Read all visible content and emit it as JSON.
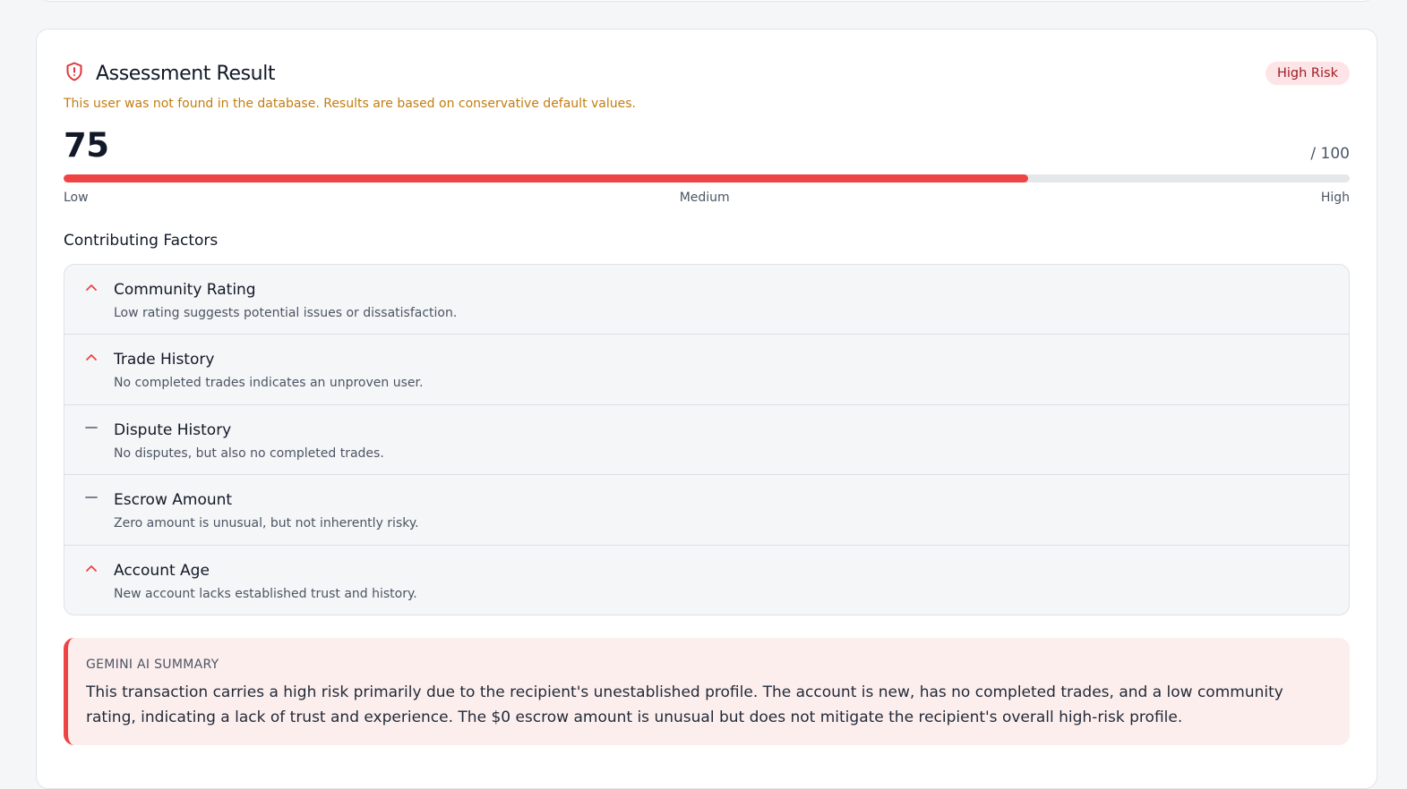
{
  "assessment": {
    "title": "Assessment Result",
    "risk_label": "High Risk",
    "notice": "This user was not found in the database. Results are based on conservative default values.",
    "score": "75",
    "score_max": "/ 100",
    "score_fraction": 0.75,
    "scale": {
      "low": "Low",
      "medium": "Medium",
      "high": "High"
    },
    "icon": "shield-alert-icon"
  },
  "factors": {
    "title": "Contributing Factors",
    "items": [
      {
        "name": "Community Rating",
        "description": "Low rating suggests potential issues or dissatisfaction.",
        "icon": "chevron-up-icon"
      },
      {
        "name": "Trade History",
        "description": "No completed trades indicates an unproven user.",
        "icon": "chevron-up-icon"
      },
      {
        "name": "Dispute History",
        "description": "No disputes, but also no completed trades.",
        "icon": "minus-icon"
      },
      {
        "name": "Escrow Amount",
        "description": "Zero amount is unusual, but not inherently risky.",
        "icon": "minus-icon"
      },
      {
        "name": "Account Age",
        "description": "New account lacks established trust and history.",
        "icon": "chevron-up-icon"
      }
    ]
  },
  "summary": {
    "label": "GEMINI AI SUMMARY",
    "text": "This transaction carries a high risk primarily due to the recipient's unestablished profile. The account is new, has no completed trades, and a low community rating, indicating a lack of trust and experience. The $0 escrow amount is unusual but does not mitigate the recipient's overall high-risk profile."
  },
  "colors": {
    "danger": "#ef4444",
    "badge_bg": "#fde4e6",
    "badge_text": "#9f1c24",
    "warning_text": "#c27d0e",
    "summary_bg": "#fdeeee"
  }
}
